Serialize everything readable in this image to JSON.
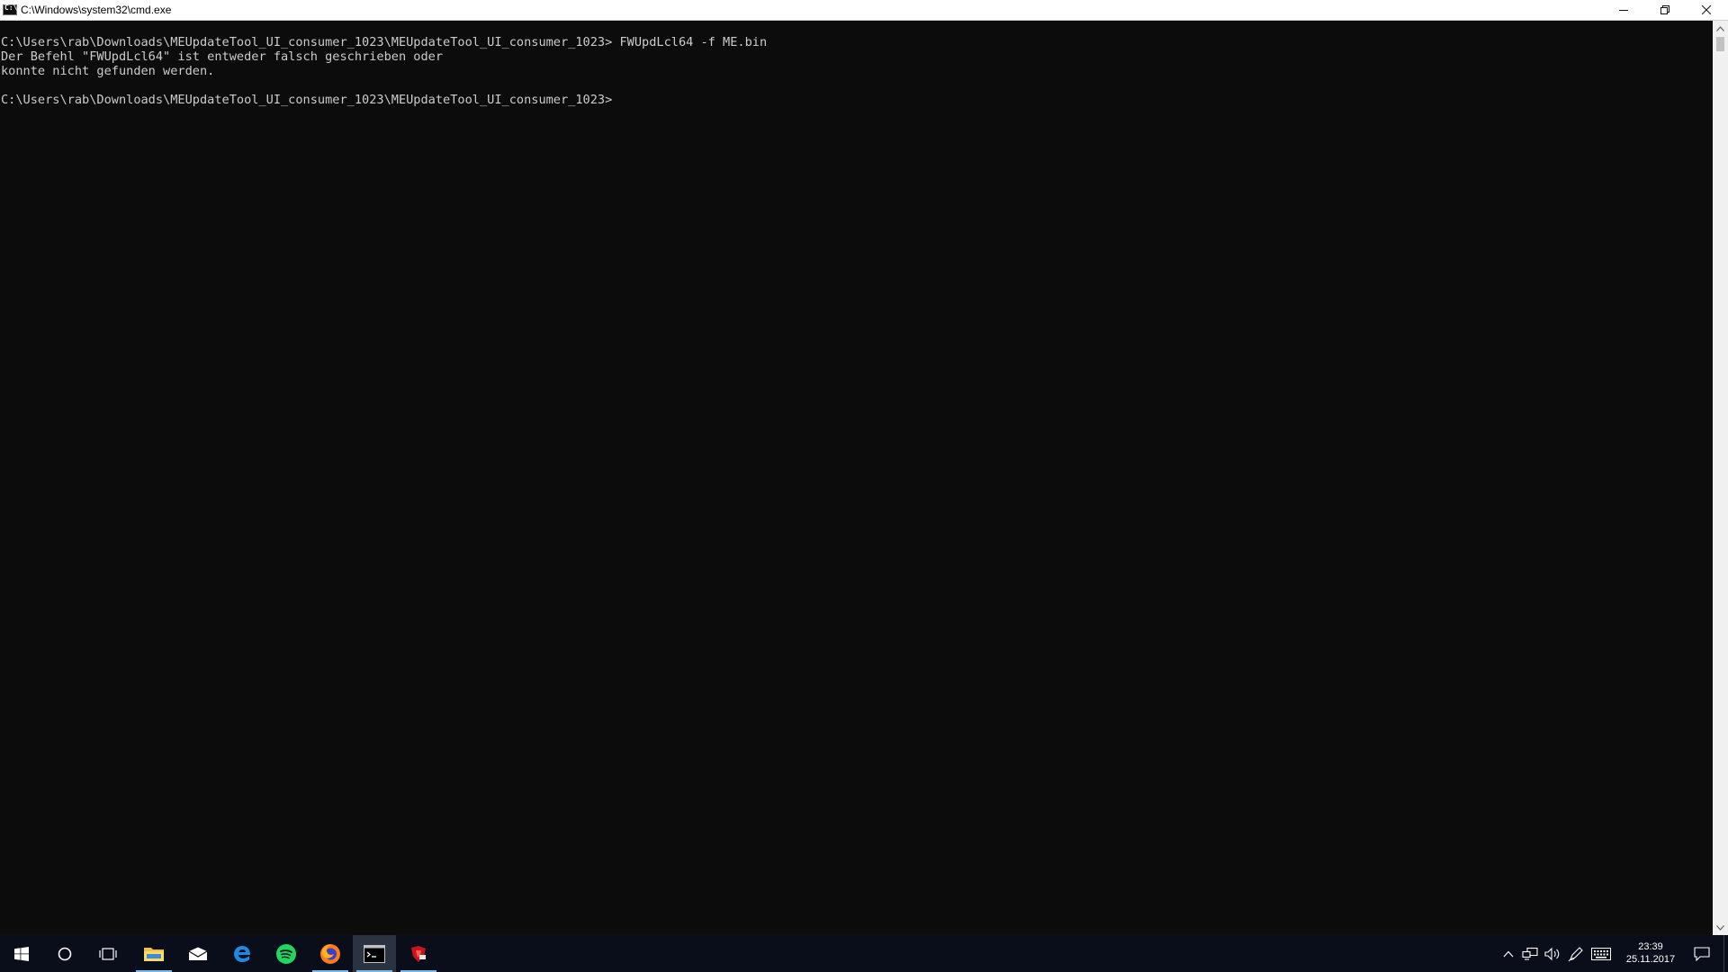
{
  "window": {
    "title": "C:\\Windows\\system32\\cmd.exe",
    "icon": "cmd-icon",
    "controls": [
      "minimize-icon",
      "restore-icon",
      "close-icon"
    ]
  },
  "console": {
    "lines": [
      "C:\\Users\\rab\\Downloads\\MEUpdateTool_UI_consumer_1023\\MEUpdateTool_UI_consumer_1023> FWUpdLcl64 -f ME.bin",
      "Der Befehl \"FWUpdLcl64\" ist entweder falsch geschrieben oder",
      "konnte nicht gefunden werden.",
      "",
      "C:\\Users\\rab\\Downloads\\MEUpdateTool_UI_consumer_1023\\MEUpdateTool_UI_consumer_1023>"
    ],
    "text_color": "#cccccc",
    "background": "#0c0c0c"
  },
  "taskbar": {
    "apps": [
      {
        "name": "start-button",
        "icon": "windows-logo-icon"
      },
      {
        "name": "cortana-button",
        "icon": "circle-icon"
      },
      {
        "name": "task-view-button",
        "icon": "task-view-icon"
      },
      {
        "name": "file-explorer",
        "icon": "folder-icon",
        "running": true
      },
      {
        "name": "mail",
        "icon": "mail-icon"
      },
      {
        "name": "edge",
        "icon": "edge-icon"
      },
      {
        "name": "spotify",
        "icon": "spotify-icon"
      },
      {
        "name": "firefox",
        "icon": "firefox-icon",
        "running": true
      },
      {
        "name": "command-prompt",
        "icon": "cmd-icon",
        "running": true,
        "active": true
      },
      {
        "name": "me-update-tool",
        "icon": "app-icon",
        "running": true
      }
    ],
    "tray": [
      "chevron-up-icon",
      "network-icon",
      "volume-icon",
      "pen-icon",
      "keyboard-icon"
    ],
    "clock": {
      "time": "23:39",
      "date": "25.11.2017"
    },
    "accent": "#76b9ed"
  }
}
